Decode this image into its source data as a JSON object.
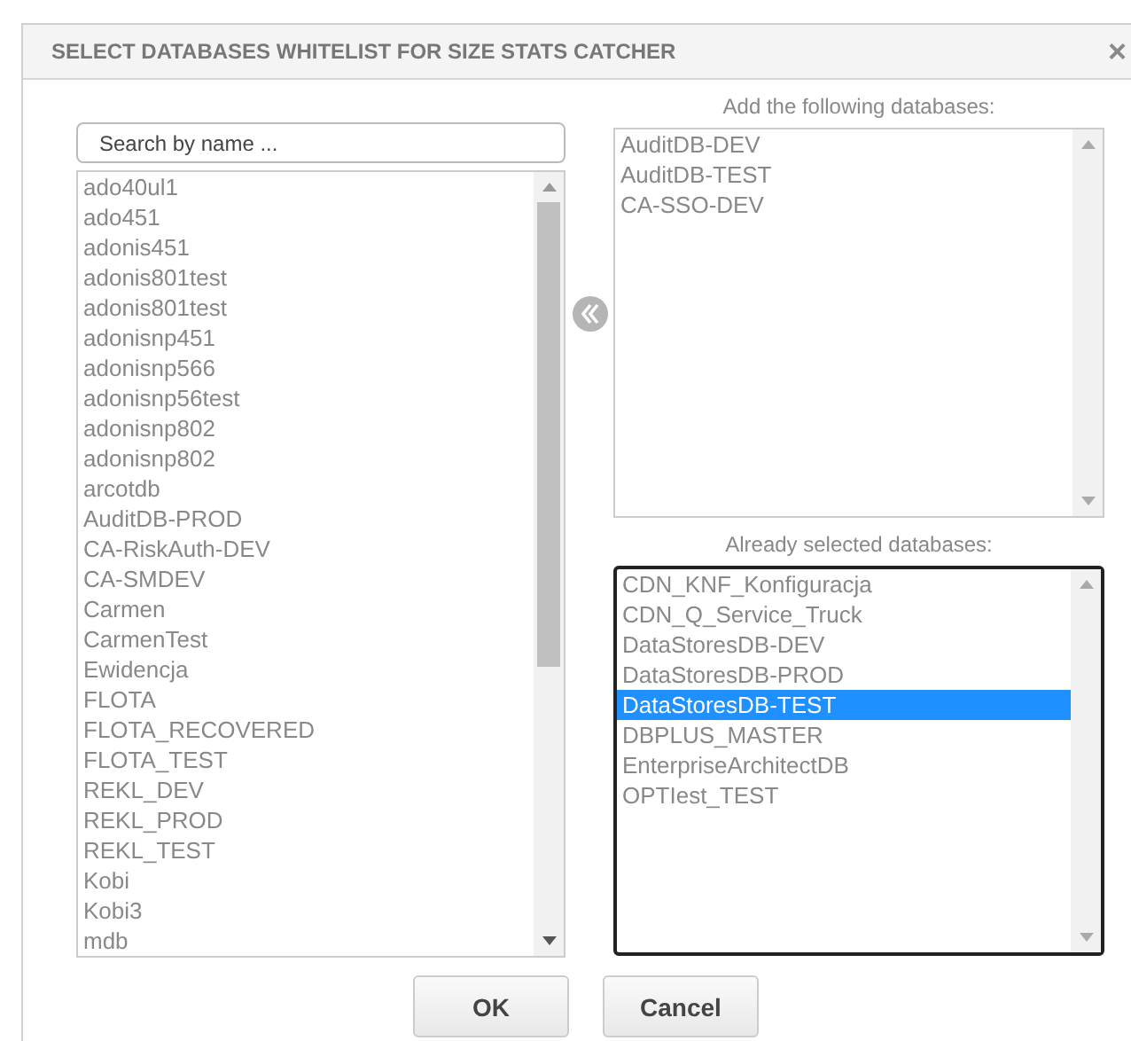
{
  "dialog": {
    "title": "SELECT DATABASES WHITELIST FOR SIZE STATS CATCHER",
    "close": "×"
  },
  "search": {
    "placeholder": "Search by name ..."
  },
  "available": [
    {
      "name": "ado40ul1",
      "selected": false
    },
    {
      "name": "ado451",
      "selected": false
    },
    {
      "name": "adonis451",
      "selected": false
    },
    {
      "name": "adonis801test",
      "selected": false
    },
    {
      "name": "adonis801test",
      "selected": false
    },
    {
      "name": "adonisnp451",
      "selected": false
    },
    {
      "name": "adonisnp566",
      "selected": false
    },
    {
      "name": "adonisnp56test",
      "selected": false
    },
    {
      "name": "adonisnp802",
      "selected": false
    },
    {
      "name": "adonisnp802",
      "selected": false
    },
    {
      "name": "arcotdb",
      "selected": false
    },
    {
      "name": "AuditDB-PROD",
      "selected": false
    },
    {
      "name": "CA-RiskAuth-DEV",
      "selected": false
    },
    {
      "name": "CA-SMDEV",
      "selected": false
    },
    {
      "name": "Carmen",
      "selected": false
    },
    {
      "name": "CarmenTest",
      "selected": false
    },
    {
      "name": "Ewidencja",
      "selected": false
    },
    {
      "name": "FLOTA",
      "selected": false
    },
    {
      "name": "FLOTA_RECOVERED",
      "selected": false
    },
    {
      "name": "FLOTA_TEST",
      "selected": false
    },
    {
      "name": "REKL_DEV",
      "selected": false
    },
    {
      "name": "REKL_PROD",
      "selected": false
    },
    {
      "name": "REKL_TEST",
      "selected": false
    },
    {
      "name": "Kobi",
      "selected": false
    },
    {
      "name": "Kobi3",
      "selected": false
    },
    {
      "name": "mdb",
      "selected": false
    }
  ],
  "to_add": {
    "label": "Add the following databases:",
    "focused": false,
    "items": [
      {
        "name": "AuditDB-DEV",
        "selected": false
      },
      {
        "name": "AuditDB-TEST",
        "selected": false
      },
      {
        "name": "CA-SSO-DEV",
        "selected": false
      }
    ]
  },
  "already_selected": {
    "label": "Already selected databases:",
    "focused": true,
    "items": [
      {
        "name": "CDN_KNF_Konfiguracja",
        "selected": false
      },
      {
        "name": "CDN_Q_Service_Truck",
        "selected": false
      },
      {
        "name": "DataStoresDB-DEV",
        "selected": false
      },
      {
        "name": "DataStoresDB-PROD",
        "selected": false
      },
      {
        "name": "DataStoresDB-TEST",
        "selected": true
      },
      {
        "name": "DBPLUS_MASTER",
        "selected": false
      },
      {
        "name": "EnterpriseArchitectDB",
        "selected": false
      },
      {
        "name": "OPTIest_TEST",
        "selected": false
      }
    ]
  },
  "buttons": [
    "OK",
    "Cancel"
  ]
}
